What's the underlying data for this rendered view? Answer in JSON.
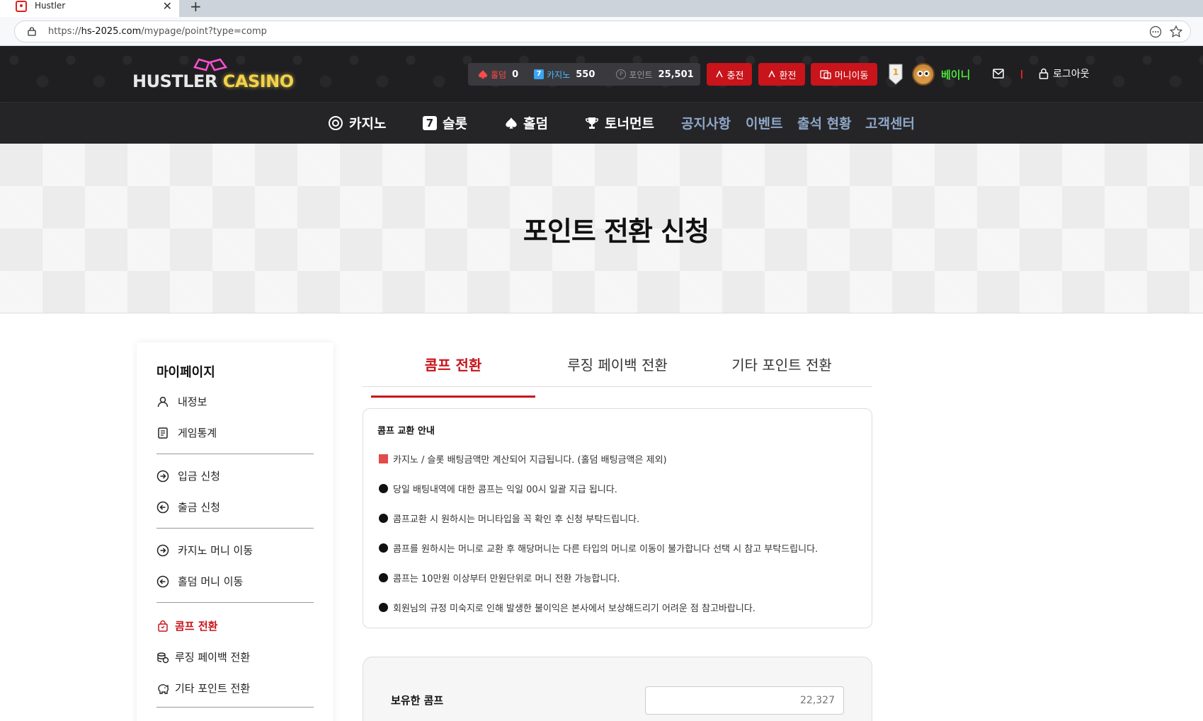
{
  "browser": {
    "tab_title": "Hustler",
    "url_scheme": "https://",
    "url_host": "hs-2025.com",
    "url_path": "/mypage/point?type=comp"
  },
  "header": {
    "logo_part1": "HUSTLER",
    "logo_part2": "CASINO",
    "wallet": {
      "holdem_label": "홀덤",
      "holdem_value": "0",
      "casino_label": "카지노",
      "casino_value": "550",
      "point_label": "포인트",
      "point_value": "25,501"
    },
    "buttons": {
      "charge": "충전",
      "exchange": "환전",
      "money_move": "머니이동"
    },
    "username": "베이니",
    "logout": "로그아웃"
  },
  "nav": {
    "casino": "카지노",
    "slot": "슬롯",
    "holdem": "홀덤",
    "tournament": "토너먼트",
    "notice": "공지사항",
    "event": "이벤트",
    "attendance": "출석 현황",
    "support": "고객센터"
  },
  "hero": {
    "title": "포인트 전환 신청"
  },
  "sidebar": {
    "title": "마이페이지",
    "items": {
      "profile": "내정보",
      "stats": "게임통계",
      "deposit": "입금 신청",
      "withdraw": "출금 신청",
      "casino_money": "카지노 머니 이동",
      "holdem_money": "홀덤 머니 이동",
      "comp": "콤프 전환",
      "losing": "루징 페이백 전환",
      "other": "기타 포인트 전환"
    }
  },
  "tabs": {
    "comp": "콤프 전환",
    "losing": "루징 페이백 전환",
    "other": "기타 포인트 전환"
  },
  "info": {
    "title": "콤프 교환 안내",
    "lines": [
      "카지노 / 슬롯 배팅금액만 계산되어 지급됩니다. (홀덤 배팅금액은 제외)",
      "당일 배팅내역에 대한 콤프는 익일 00시 일괄 지급 됩니다.",
      "콤프교환 시 원하시는 머니타입을 꼭 확인 후 신청 부탁드립니다.",
      "콤프를 원하시는 머니로 교환 후 해당머니는 다른 타입의 머니로 이동이 불가합니다 선택 시 참고 부탁드립니다.",
      "콤프는 10만원 이상부터 만원단위로 머니 전환 가능합니다.",
      "회원님의 규정 미숙지로 인해 발생한 불이익은 본사에서 보상해드리기 어려운 점 참고바랍니다."
    ]
  },
  "comp": {
    "label": "보유한 콤프",
    "placeholder": "22,327"
  },
  "colors": {
    "accent": "#c8141a",
    "username": "#4be03a",
    "nav_sub": "#8fa7c8"
  }
}
